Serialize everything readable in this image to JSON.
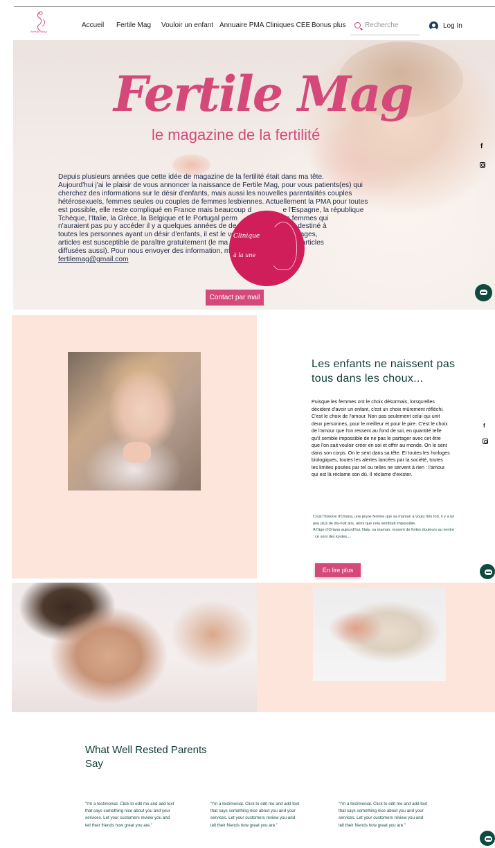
{
  "header": {
    "logo_text": "Fertile Mag",
    "nav": [
      {
        "label": "Accueil"
      },
      {
        "label": "Fertile Mag"
      },
      {
        "label": "Vouloir un enfant"
      },
      {
        "label": "Annuaire PMA Cliniques CEE"
      },
      {
        "label": "Bonus plus"
      }
    ],
    "search_placeholder": "Recherche",
    "login_label": "Log In"
  },
  "hero": {
    "title": "Fertile Mag",
    "subtitle": "le magazine de la fertilité",
    "body_lines": [
      "Depuis plusieurs années que cette idée de magazine de la fertilité était dans ma tête.",
      "Aujourd'hui j'ai le plaisir de vous annoncer la naissance de Fertile Mag, pour vous patients(es) qui",
      "cherchez des informations sur le désir d'enfants, mais aussi les nouvelles parentalités couples",
      "hétérosexuels, femmes seules ou couples de femmes lesbiennes. Actuellement la PMA pour toutes",
      "est possible, elle reste compliqué en France mais beaucoup d                e l'Espagne, la république",
      "Tchèque, l'Italie, la Grèce, la Belgique et le Portugal perm                ou des femmes qui",
      "n'auraient pas pu y accéder il y a quelques années de de                  zine est destiné à",
      "toutes les personnes ayant un désir d'enfants, il est le vo                ées, reportages,",
      "articles est susceptible de paraître gratuitement (le ma                 gratuit et les articles",
      "diffusées aussi). Pour nous envoyer des information, ma                 mail :"
    ],
    "email": "fertilemag@gmail.com",
    "contact_button": "Contact par mail",
    "badge_line1": "Clinique",
    "badge_line2": "à la une"
  },
  "social": {
    "facebook": "f"
  },
  "section2": {
    "title": "Les enfants ne naissent pas tous dans les choux...",
    "paragraph": "Puisque les femmes ont le choix désormais, lorsqu'elles décident d'avoir un enfant, c'est un choix mûrement réfléchi. C'est le choix de l'amour. Non pas seulement celui qui unit deux personnes, pour le meilleur et pour le pire. C'est le choix de l'amour que l'on ressent au fond de soi, en quantité telle qu'il semble impossible de ne pas le partager avec cet être que l'on sait vouloir créer en soi et offrir au monde. On le sent dans son corps. On le sent dans sa tête. Et toutes les horloges biologiques, toutes les alertes lancées par la société, toutes les limites posées par tel ou telles ne servent à rien : l'amour qui est là réclame son dû. Il réclame d'exister.",
    "story_1": "C'est l'histoire d'Oriana, une jeune femme que sa maman a voulu très fort,  il y a un peu plus de dix-huit ans, alors que cela semblait impossible.",
    "story_2": "A l'âge d'Oriana aujourd'hui, Naty, sa maman, ressent de fortes douleurs au ventre : ce sont des kystes....",
    "button": "En lire plus"
  },
  "testimonials": {
    "title": "What Well Rested Parents Say",
    "items": [
      {
        "text": "\"I'm a testimonial. Click to edit me and add text that says something nice about you and your services. Let your customers review you and tell their friends how great you are.\""
      },
      {
        "text": "\"I'm a testimonial. Click to edit me and add text that says something nice about you and your services. Let your customers review you and tell their friends how great you are.\""
      },
      {
        "text": "\"I'm a testimonial. Click to edit me and add text that says something nice about you and your services. Let your customers review you and tell their friends how great you are.\""
      }
    ]
  },
  "colors": {
    "accent": "#d4497a",
    "badge": "#d01e5a",
    "heading": "#0d3b35",
    "peach": "#fde5dc",
    "chat": "#0f4a3f"
  }
}
